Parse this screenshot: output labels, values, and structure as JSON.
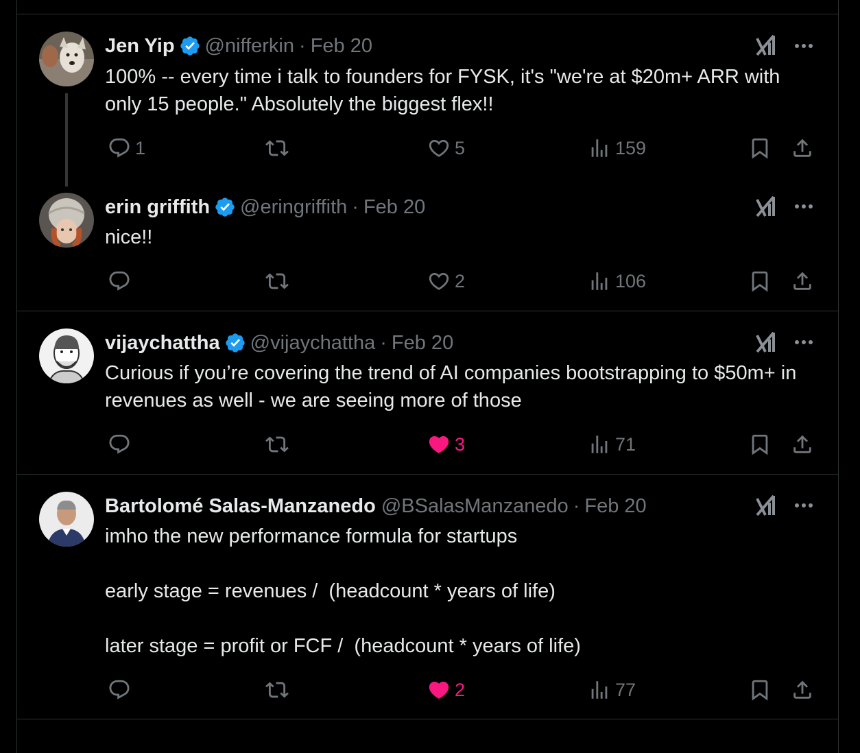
{
  "tweets": [
    {
      "name": "Jen Yip",
      "handle": "@nifferkin",
      "sep": "·",
      "date": "Feb 20",
      "body": "100% -- every time i talk to founders for FYSK, it's \"we're at $20m+ ARR with only 15 people.\" Absolutely the biggest flex!!",
      "replies": "1",
      "reposts": "",
      "likes": "5",
      "views": "159",
      "liked": false
    },
    {
      "name": "erin griffith",
      "handle": "@eringriffith",
      "sep": "·",
      "date": "Feb 20",
      "body": "nice!!",
      "replies": "",
      "reposts": "",
      "likes": "2",
      "views": "106",
      "liked": false
    },
    {
      "name": "vijaychattha",
      "handle": "@vijaychattha",
      "sep": "·",
      "date": "Feb 20",
      "body": "Curious if you’re covering the trend of AI companies bootstrapping to $50m+ in revenues as well - we are seeing more of those",
      "replies": "",
      "reposts": "",
      "likes": "3",
      "views": "71",
      "liked": true
    },
    {
      "name": "Bartolomé Salas-Manzanedo",
      "handle": "@BSalasManzanedo",
      "sep": "·",
      "date": "Feb 20",
      "body": "imho the new performance formula for startups\n\nearly stage = revenues /  (headcount * years of life)\n\nlater stage = profit or FCF /  (headcount * years of life)",
      "replies": "",
      "reposts": "",
      "likes": "2",
      "views": "77",
      "liked": true
    }
  ],
  "colors": {
    "background": "#000000",
    "text": "#e7e9ea",
    "muted": "#71767b",
    "verified": "#1d9bf0",
    "like": "#f91880",
    "border": "#2f3336"
  },
  "icons": [
    "verified-badge-icon",
    "grok-icon",
    "more-icon",
    "reply-icon",
    "repost-icon",
    "like-icon",
    "views-icon",
    "bookmark-icon",
    "share-icon"
  ]
}
